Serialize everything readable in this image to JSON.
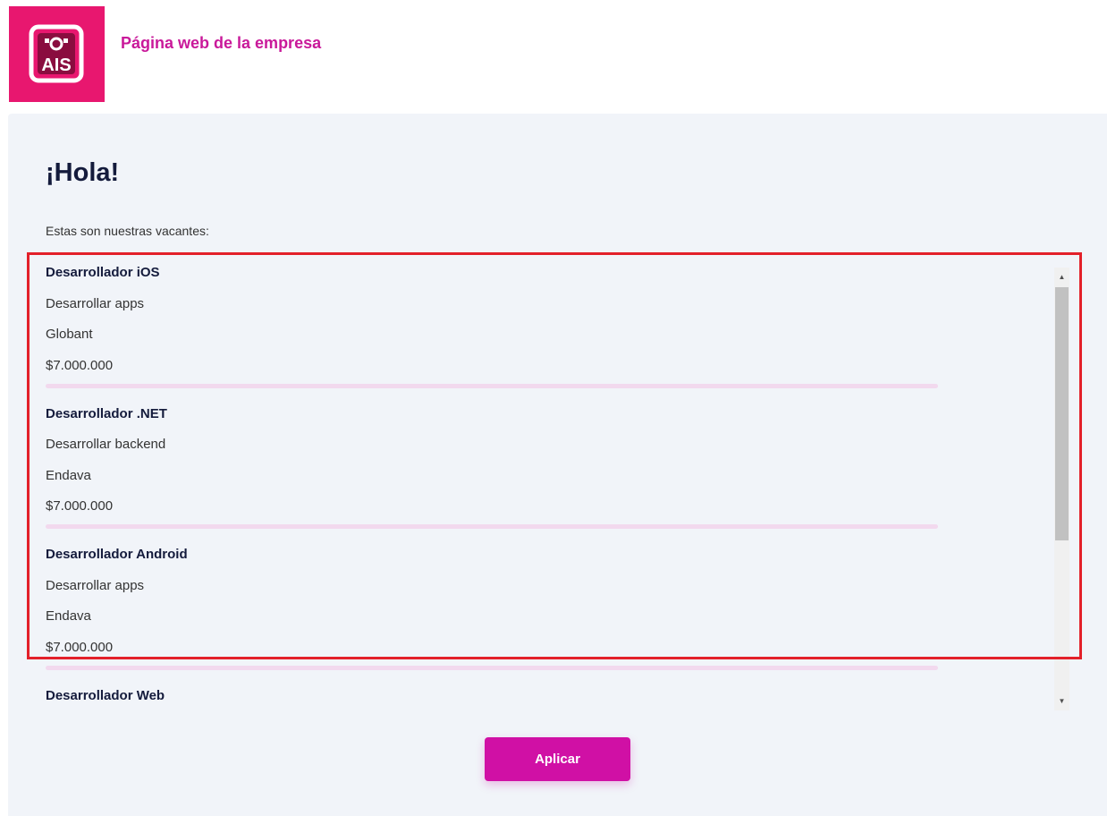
{
  "header": {
    "logo_text": "AIS",
    "company_link": "Página web de la empresa",
    "brand_color": "#e8176f",
    "link_color": "#c9199a"
  },
  "main": {
    "greeting": "¡Hola!",
    "intro": "Estas son nuestras vacantes:",
    "jobs": [
      {
        "title": "Desarrollador iOS",
        "description": "Desarrollar apps",
        "company": "Globant",
        "salary": "$7.000.000"
      },
      {
        "title": "Desarrollador .NET",
        "description": "Desarrollar backend",
        "company": "Endava",
        "salary": "$7.000.000"
      },
      {
        "title": "Desarrollador Android",
        "description": "Desarrollar apps",
        "company": "Endava",
        "salary": "$7.000.000"
      },
      {
        "title": "Desarrollador Web"
      }
    ],
    "apply_button": "Aplicar",
    "accent_color": "#d010a5",
    "highlight_color": "#e3202a"
  },
  "icons": {
    "scroll_up": "scroll-up-arrow-icon",
    "scroll_down": "scroll-down-arrow-icon"
  }
}
